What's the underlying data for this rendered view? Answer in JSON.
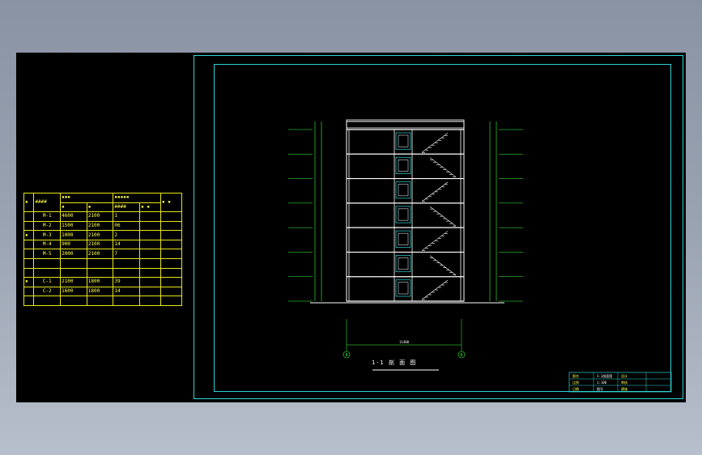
{
  "colors": {
    "cyan": "#2fd3d3",
    "yellow": "#ffff44",
    "green": "#3cff3c",
    "white": "#ffffff",
    "background": "#000000"
  },
  "schedule": {
    "header_row1": [
      "▪",
      "####",
      "▪▪▪",
      "▪▪▪▪▪",
      "▪ ▪"
    ],
    "header_row2": [
      "▪",
      "▪",
      "▪",
      "####",
      "▪ ▪"
    ],
    "rows": [
      {
        "type": "",
        "code": "M-1",
        "w": "4600",
        "h": "2100",
        "n": "1"
      },
      {
        "type": "",
        "code": "M-2",
        "w": "1500",
        "h": "2100",
        "n": "06"
      },
      {
        "type": "▪",
        "code": "M-3",
        "w": "1000",
        "h": "2100",
        "n": "2"
      },
      {
        "type": "",
        "code": "M-4",
        "w": "900",
        "h": "2100",
        "n": "14"
      },
      {
        "type": "",
        "code": "M-5",
        "w": "2000",
        "h": "2100",
        "n": "7"
      },
      {
        "type": "",
        "code": "",
        "w": "",
        "h": "",
        "n": ""
      },
      {
        "type": "",
        "code": "",
        "w": "",
        "h": "",
        "n": ""
      },
      {
        "type": "▪",
        "code": "C-1",
        "w": "2100",
        "h": "1800",
        "n": "39"
      },
      {
        "type": "",
        "code": "C-2",
        "w": "1600",
        "h": "1800",
        "n": "14"
      },
      {
        "type": "",
        "code": "",
        "w": "",
        "h": "",
        "n": ""
      }
    ],
    "title": "▪ ▪ ▪"
  },
  "drawing": {
    "section_title": "1-1 剖 面 图",
    "axis_left": "A",
    "axis_right": "D",
    "dimension_label": "11400",
    "floors": 7
  },
  "title_block": {
    "cells": [
      "图名",
      "1-1剖面图",
      "设计",
      "比例",
      "1:100",
      "审核",
      "日期",
      "图号",
      "建施"
    ]
  }
}
